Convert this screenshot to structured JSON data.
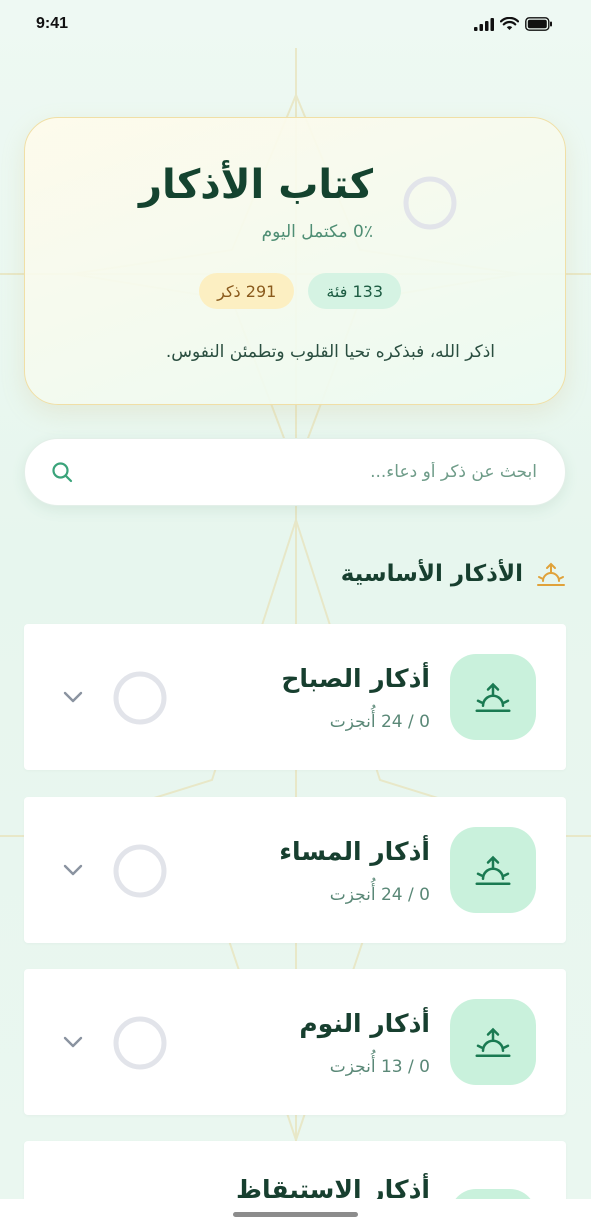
{
  "status_bar": {
    "time": "9:41"
  },
  "hero": {
    "title": "كتاب الأذكار",
    "progress_text": "0٪ مكتمل اليوم",
    "progress_value": 0,
    "categories_badge": "133 فئة",
    "dhikr_badge": "291 ذكر",
    "quote": "اذكر الله، فبذكره تحيا القلوب وتطمئن النفوس."
  },
  "search": {
    "placeholder": "ابحث عن ذكر أو دعاء..."
  },
  "section": {
    "title": "الأذكار الأساسية",
    "icon": "sunrise-icon"
  },
  "cards": [
    {
      "title": "أذكار الصباح",
      "progress": "0 / 24 أُنجزت",
      "done": 0,
      "total": 24,
      "icon": "sunrise-icon"
    },
    {
      "title": "أذكار المساء",
      "progress": "0 / 24 أُنجزت",
      "done": 0,
      "total": 24,
      "icon": "sunrise-icon"
    },
    {
      "title": "أذكار النوم",
      "progress": "0 / 13 أُنجزت",
      "done": 0,
      "total": 13,
      "icon": "sunrise-icon"
    },
    {
      "title": "أذكار الاستيقاظ",
      "icon": "sunrise-icon"
    }
  ],
  "colors": {
    "background": "#eef9f3",
    "primary_green": "#1a7a52",
    "accent_gold": "#e0a23a",
    "icon_tile": "#c9f1dc",
    "ring_gray": "#e2e4ea"
  }
}
